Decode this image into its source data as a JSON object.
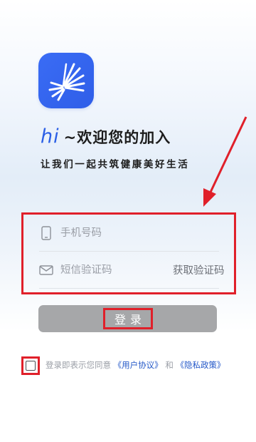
{
  "headline": {
    "hi": "hi",
    "rest": "~欢迎您的加入",
    "subtitle": "让我们一起共筑健康美好生活"
  },
  "form": {
    "phone_placeholder": "手机号码",
    "code_placeholder": "短信验证码",
    "get_code_label": "获取验证码"
  },
  "login": {
    "label": "登录"
  },
  "agreement": {
    "prefix": "登录即表示您同意",
    "user_agreement": "《用户协议》",
    "and": "和",
    "privacy_policy": "《隐私政策》"
  },
  "icons": {
    "logo": "app-logo-icon",
    "phone": "phone-icon",
    "sms": "envelope-icon"
  },
  "colors": {
    "brand": "#2f5ee8",
    "highlight": "#e0202a",
    "button_disabled": "#a6a7a9",
    "link": "#2458c8"
  }
}
